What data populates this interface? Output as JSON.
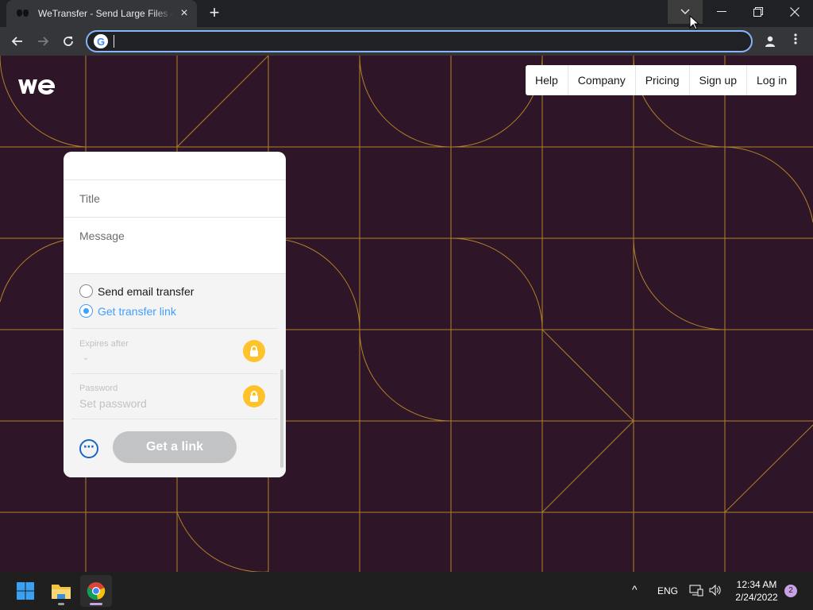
{
  "browser": {
    "tab_title": "WeTransfer - Send Large Files & S",
    "tab_close_icon": "×",
    "new_tab_icon": "+",
    "address_value": "",
    "window_controls": {
      "minimize": "—",
      "restore": "❐",
      "close": "✕",
      "tab_search": "⌄"
    }
  },
  "site": {
    "logo_text": "we",
    "nav": [
      "Help",
      "Company",
      "Pricing",
      "Sign up",
      "Log in"
    ],
    "colors": {
      "background": "#2e1528",
      "pattern_line": "#c8952a",
      "accent": "#409fff",
      "lock": "#fec32a"
    }
  },
  "transfer_form": {
    "title_placeholder": "Title",
    "message_placeholder": "Message",
    "options": [
      {
        "label": "Send email transfer",
        "checked": false
      },
      {
        "label": "Get transfer link",
        "checked": true
      }
    ],
    "expires_label": "Expires after",
    "password_label": "Password",
    "password_placeholder": "Set password",
    "more_icon": "⋯",
    "submit_label": "Get a link"
  },
  "taskbar": {
    "tray_chevron": "^",
    "language": "ENG",
    "time": "12:34 AM",
    "date": "2/24/2022",
    "notification_count": "2"
  }
}
